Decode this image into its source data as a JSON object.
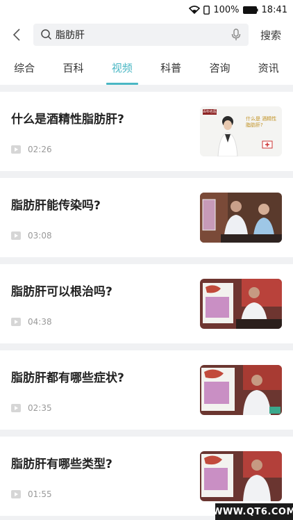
{
  "status_bar": {
    "battery": "100%",
    "time": "18:41"
  },
  "search": {
    "value": "脂肪肝",
    "button_label": "搜索"
  },
  "tabs": [
    {
      "label": "综合"
    },
    {
      "label": "百科"
    },
    {
      "label": "视频",
      "active": true
    },
    {
      "label": "科普"
    },
    {
      "label": "咨询"
    },
    {
      "label": "资讯"
    }
  ],
  "videos": [
    {
      "title": "什么是酒精性脂肪肝?",
      "duration": "02:26",
      "thumb_caption": "什么是 酒精性脂肪肝?",
      "thumb_logo": "百科名医"
    },
    {
      "title": "脂肪肝能传染吗?",
      "duration": "03:08"
    },
    {
      "title": "脂肪肝可以根治吗?",
      "duration": "04:38"
    },
    {
      "title": "脂肪肝都有哪些症状?",
      "duration": "02:35"
    },
    {
      "title": "脂肪肝有哪些类型?",
      "duration": "01:55"
    }
  ],
  "watermark": "WWW.QT6.COM",
  "colors": {
    "accent": "#4ab7c4",
    "divider": "#f0f1f3"
  }
}
